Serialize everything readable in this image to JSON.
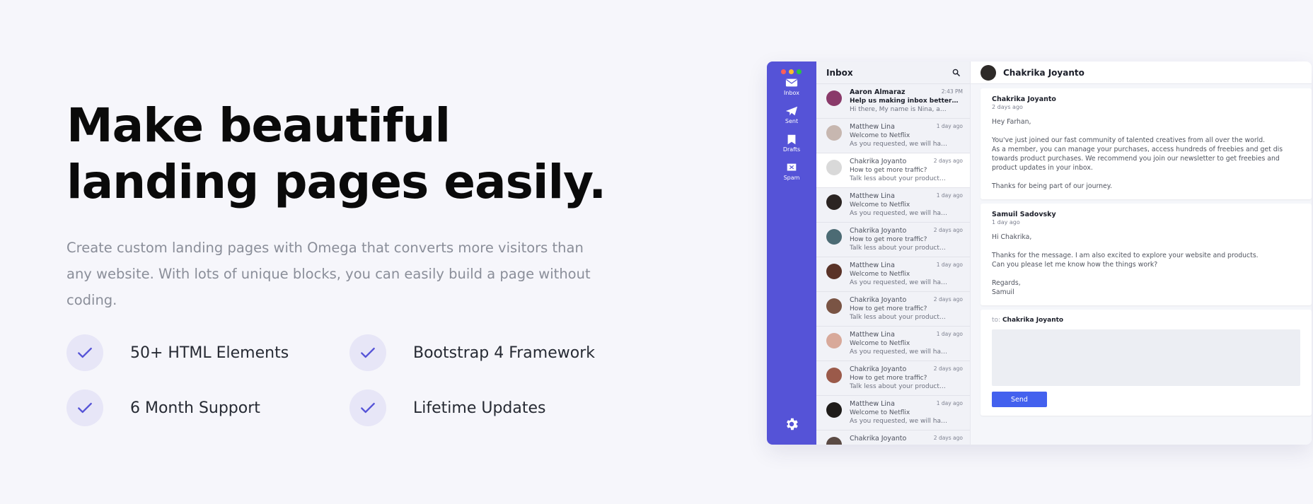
{
  "hero": {
    "title_line1": "Make beautiful",
    "title_line2": "landing pages easily.",
    "description": "Create custom landing pages with Omega that converts more visitors than any website. With lots of unique blocks, you can easily build a page without coding.",
    "features": [
      "50+ HTML Elements",
      "Bootstrap 4 Framework",
      "6 Month Support",
      "Lifetime Updates"
    ]
  },
  "colors": {
    "accent": "#5553d7",
    "check_bg": "#e7e6f7",
    "send_button": "#4361ee"
  },
  "app": {
    "window_dots": [
      "#ff5f57",
      "#febc2e",
      "#28c840"
    ],
    "nav": [
      {
        "icon": "inbox-icon",
        "label": "Inbox"
      },
      {
        "icon": "paper-plane-icon",
        "label": "Sent"
      },
      {
        "icon": "bookmark-icon",
        "label": "Drafts"
      },
      {
        "icon": "spam-icon",
        "label": "Spam"
      }
    ],
    "settings_icon": "gear-icon",
    "list_title": "Inbox",
    "search_icon": "search-icon",
    "messages": [
      {
        "name": "Aaron Almaraz",
        "time": "2:43 PM",
        "subject": "Help us making inbox better…",
        "preview": "Hi there, My name is Nina, a…",
        "unread": true,
        "avatar": "#8a3a6a"
      },
      {
        "name": "Matthew Lina",
        "time": "1 day ago",
        "subject": "Welcome to Netflix",
        "preview": "As you requested, we will ha…",
        "avatar": "#c7b7b0"
      },
      {
        "name": "Chakrika Joyanto",
        "time": "2 days ago",
        "subject": "How to get more traffic?",
        "preview": "Talk less about your product…",
        "active": true,
        "avatar": "#d9d9d9"
      },
      {
        "name": "Matthew Lina",
        "time": "1 day ago",
        "subject": "Welcome to Netflix",
        "preview": "As you requested, we will ha…",
        "avatar": "#2b2422"
      },
      {
        "name": "Chakrika Joyanto",
        "time": "2 days ago",
        "subject": "How to get more traffic?",
        "preview": "Talk less about your product…",
        "avatar": "#4c6b74"
      },
      {
        "name": "Matthew Lina",
        "time": "1 day ago",
        "subject": "Welcome to Netflix",
        "preview": "As you requested, we will ha…",
        "avatar": "#5a3328"
      },
      {
        "name": "Chakrika Joyanto",
        "time": "2 days ago",
        "subject": "How to get more traffic?",
        "preview": "Talk less about your product…",
        "avatar": "#7a5444"
      },
      {
        "name": "Matthew Lina",
        "time": "1 day ago",
        "subject": "Welcome to Netflix",
        "preview": "As you requested, we will ha…",
        "avatar": "#d8a99a"
      },
      {
        "name": "Chakrika Joyanto",
        "time": "2 days ago",
        "subject": "How to get more traffic?",
        "preview": "Talk less about your product…",
        "avatar": "#9b5a4a"
      },
      {
        "name": "Matthew Lina",
        "time": "1 day ago",
        "subject": "Welcome to Netflix",
        "preview": "As you requested, we will ha…",
        "avatar": "#1f1c1a"
      },
      {
        "name": "Chakrika Joyanto",
        "time": "2 days ago",
        "subject": "",
        "preview": "",
        "avatar": "#5a4a44"
      }
    ],
    "thread": {
      "contact": "Chakrika Joyanto",
      "cards": [
        {
          "from": "Chakrika Joyanto",
          "when": "2 days ago",
          "body": "Hey Farhan,\n\nYou've just joined our fast community of talented creatives from all over the world.\nAs a member, you can manage your purchases, access hundreds of freebies and get dis\ntowards product purchases. We recommend you join our newsletter to get freebies and\nproduct updates in your inbox.\n\nThanks for being part of our journey."
        },
        {
          "from": "Samuil Sadovsky",
          "when": "1 day ago",
          "body": "Hi Chakrika,\n\nThanks for the message. I am also excited to explore your website and products.\nCan you please let me know how the things work?\n\nRegards,\nSamuil"
        }
      ],
      "reply_prefix": "to:",
      "reply_to": "Chakrika Joyanto",
      "send_label": "Send"
    }
  }
}
